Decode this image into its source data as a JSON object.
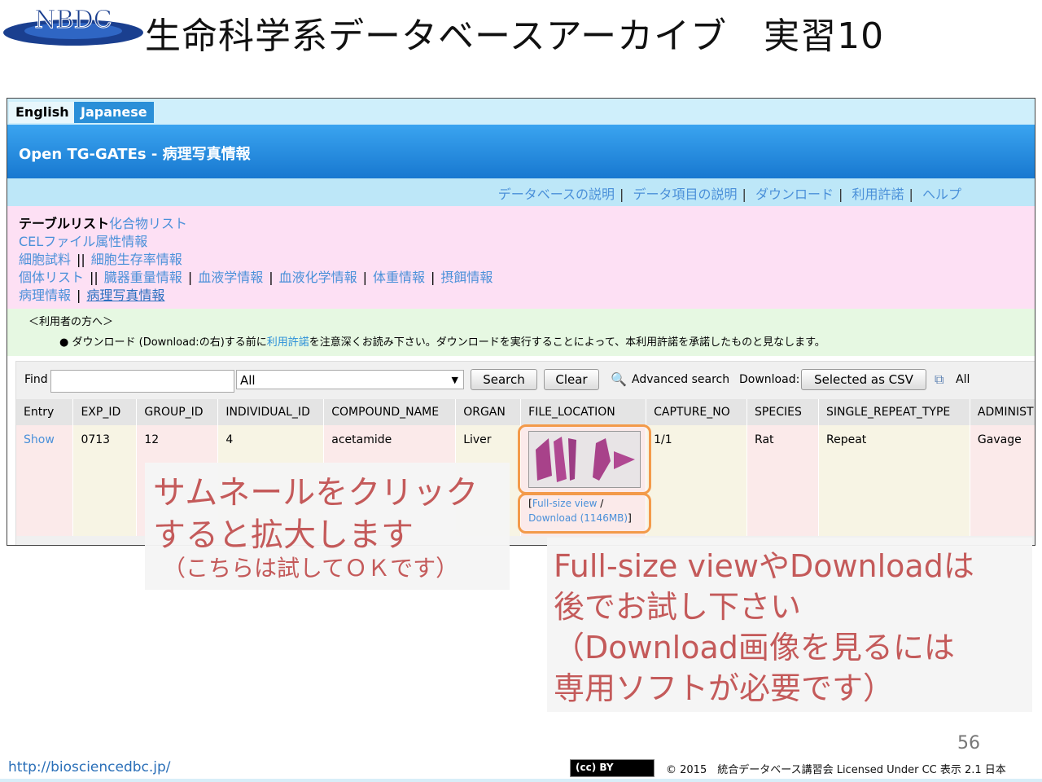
{
  "slide": {
    "logo_text": "NBDC",
    "title": "生命科学系データベースアーカイブ　実習10",
    "page_number": "56",
    "footer_url": "http://biosciencedbc.jp/",
    "cc_badge": "(cc) BY",
    "footer_copyright": "© 2015　統合データベース講習会 Licensed Under CC 表示 2.1 日本"
  },
  "app": {
    "lang_tabs": [
      "English",
      "Japanese"
    ],
    "title": "Open TG-GATEs - 病理写真情報",
    "top_nav": [
      "データベースの説明",
      "データ項目の説明",
      "ダウンロード",
      "利用許諾",
      "ヘルプ"
    ],
    "table_nav": {
      "label": "テーブルリスト",
      "row1": [
        "化合物リスト"
      ],
      "row2": [
        "CELファイル属性情報"
      ],
      "row3": [
        "細胞試料",
        "細胞生存率情報"
      ],
      "row4": [
        "個体リスト",
        "臓器重量情報",
        "血液学情報",
        "血液化学情報",
        "体重情報",
        "摂餌情報"
      ],
      "row5": [
        "病理情報",
        "病理写真情報"
      ]
    },
    "notice": {
      "heading": "＜利用者の方へ＞",
      "bullet": "●",
      "text_before": "ダウンロード (Download:の右)する前に",
      "link": "利用許諾",
      "text_after": "を注意深くお読み下さい。ダウンロードを実行することによって、本利用許諾を承諾したものと見なします。"
    },
    "toolbar": {
      "find_label": "Find",
      "find_value": "",
      "field_select": "All",
      "search_label": "Search",
      "clear_label": "Clear",
      "advanced_search": "Advanced search",
      "download_label": "Download:",
      "csv_label": "Selected as CSV",
      "all_label": "All"
    },
    "table": {
      "columns": [
        "Entry",
        "EXP_ID",
        "GROUP_ID",
        "INDIVIDUAL_ID",
        "COMPOUND_NAME",
        "ORGAN",
        "FILE_LOCATION",
        "CAPTURE_NO",
        "SPECIES",
        "SINGLE_REPEAT_TYPE",
        "ADMINIST"
      ],
      "row": {
        "entry": "Show",
        "exp_id": "0713",
        "group_id": "12",
        "individual_id": "4",
        "compound_name": "acetamide",
        "organ": "Liver",
        "capture_no": "1/1",
        "species": "Rat",
        "single_repeat_type": "Repeat",
        "administ": "Gavage",
        "file_links": {
          "open": "[",
          "full_view": "Full-size view",
          "slash": " /",
          "download": "Download (1146MB)",
          "close": "]"
        }
      }
    }
  },
  "annotations": {
    "left": {
      "line1": "サムネールをクリック",
      "line2": "すると拡大します",
      "line3": "（こちらは試してＯＫです）"
    },
    "right": {
      "line1": "Full-size viewやDownloadは",
      "line2": "後でお試し下さい",
      "line3": "（Download画像を見るには",
      "line4": "専用ソフトが必要です）"
    }
  },
  "colors": {
    "banner": "#1878d0",
    "annotation_text": "#c45a5a",
    "annotation_border": "#f39a4a",
    "link": "#4a90d9"
  }
}
